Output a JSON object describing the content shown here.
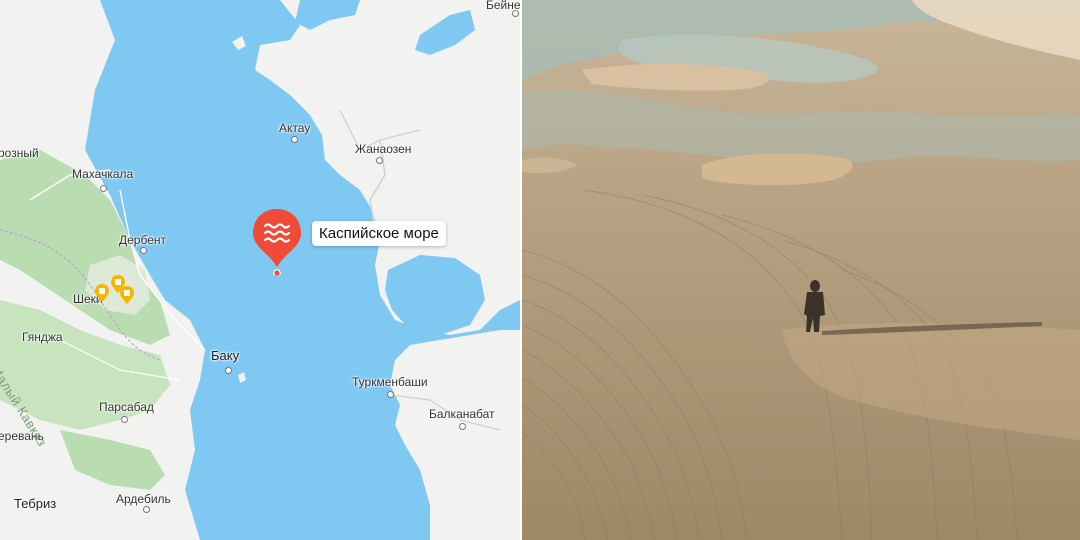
{
  "colors": {
    "sea": "#7ec8f2",
    "land": "#f2f2f0",
    "forest": "#b9dcb0",
    "pin": "#ef4b37",
    "poi": "#f7b500"
  },
  "map": {
    "sea_label": "Каспийское море",
    "sea_icon": "waves-icon",
    "cities": {
      "beineu": "Бейнеу",
      "grozny": "розный",
      "makhachkala": "Махачкала",
      "aktau": "Актау",
      "zhanaozen": "Жанаозен",
      "derbent": "Дербент",
      "sheki": "Шеки",
      "ganja": "Гянджа",
      "baku": "Баку",
      "turkmenbashi": "Туркменбаши",
      "parsabad": "Парсабад",
      "balkanabat": "Балканабат",
      "yerevan": "еревань",
      "ardabil": "Ардебиль",
      "tabriz": "Тебриз"
    },
    "region_label": "Малый Кавказ",
    "poi_icon": "map-marker-icon"
  },
  "photo": {
    "subject": "person-figure"
  }
}
